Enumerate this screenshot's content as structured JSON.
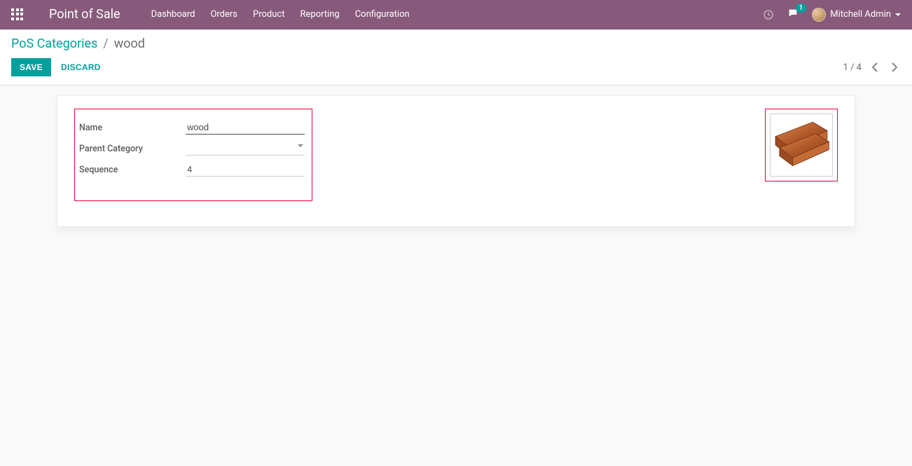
{
  "navbar": {
    "brand": "Point of Sale",
    "menu": [
      "Dashboard",
      "Orders",
      "Product",
      "Reporting",
      "Configuration"
    ],
    "chat_badge": "1",
    "user_name": "Mitchell Admin"
  },
  "breadcrumb": {
    "root": "PoS Categories",
    "separator": "/",
    "current": "wood"
  },
  "buttons": {
    "save": "SAVE",
    "discard": "DISCARD"
  },
  "pager": {
    "text": "1 / 4"
  },
  "form": {
    "name_label": "Name",
    "name_value": "wood",
    "parent_label": "Parent Category",
    "parent_value": "",
    "sequence_label": "Sequence",
    "sequence_value": "4"
  }
}
